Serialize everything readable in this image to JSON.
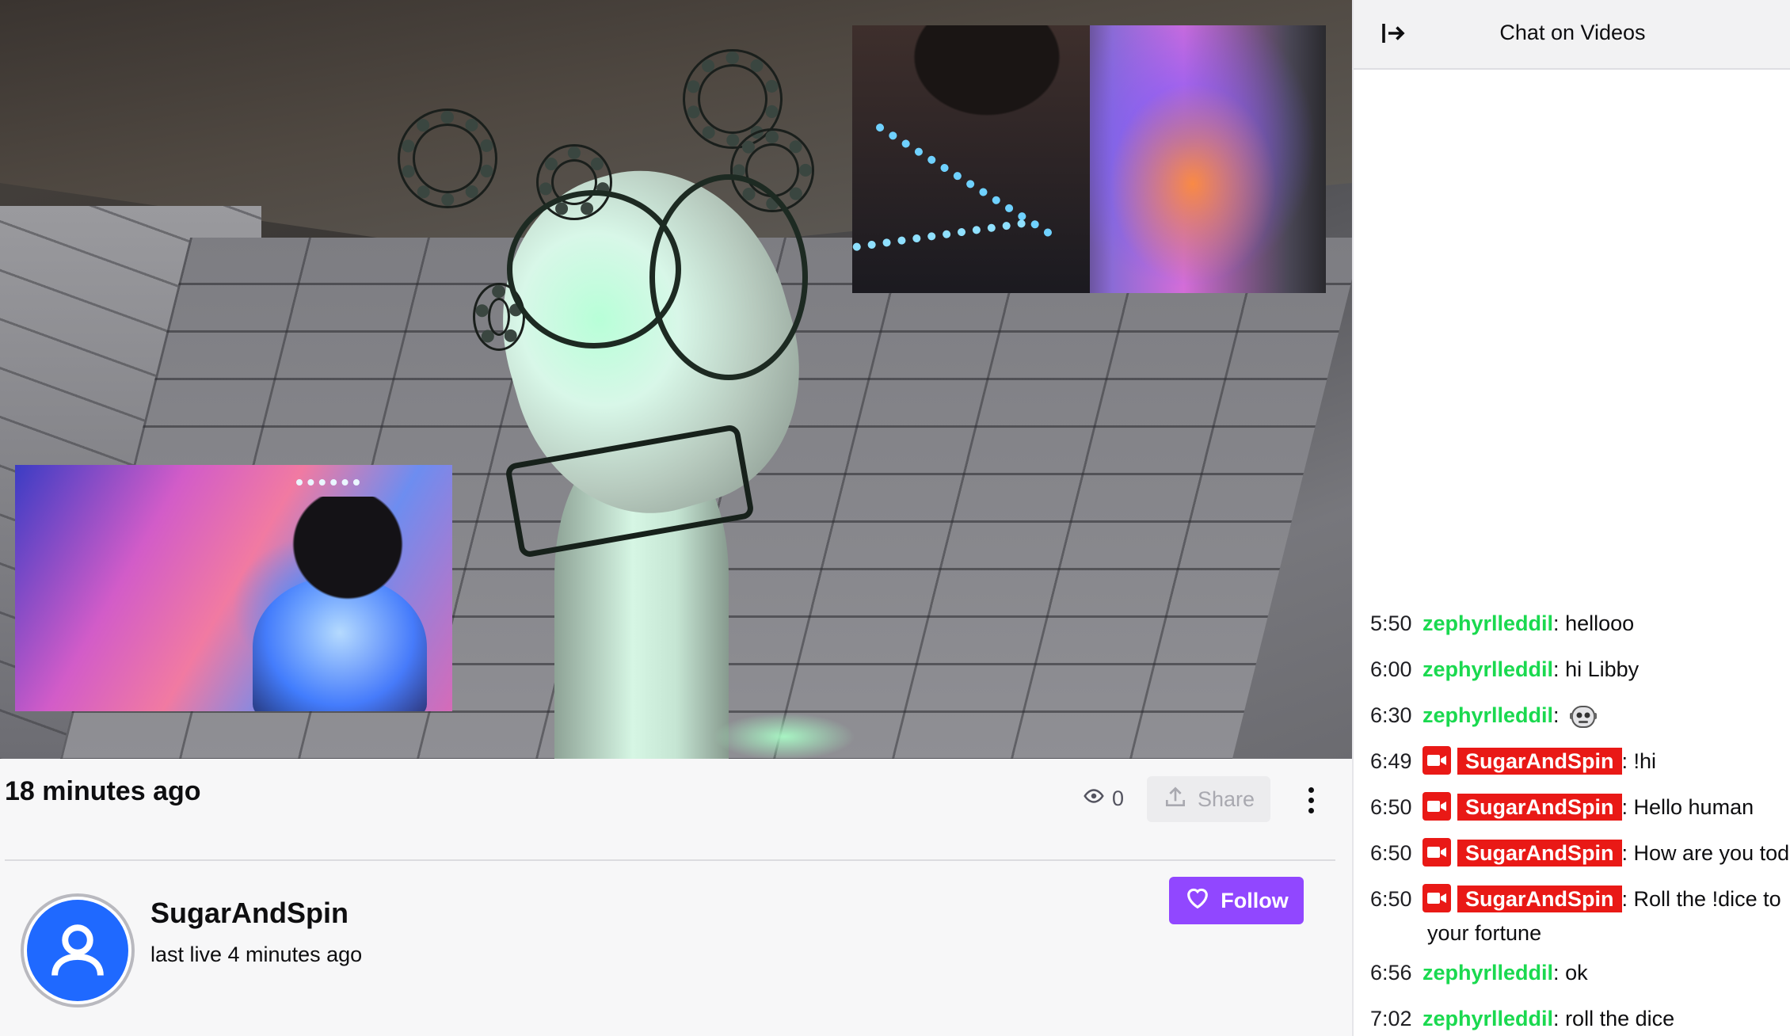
{
  "video": {
    "time_ago": "18 minutes ago",
    "view_count": "0",
    "share_label": "Share"
  },
  "channel": {
    "name": "SugarAndSpin",
    "status": "last live 4 minutes ago",
    "follow_label": "Follow"
  },
  "chat": {
    "title": "Chat on Videos",
    "messages": [
      {
        "time": "5:50",
        "user": "zephyrlleddil",
        "text": "hellooo"
      },
      {
        "time": "6:00",
        "user": "zephyrlleddil",
        "text": "hi Libby"
      },
      {
        "time": "6:30",
        "user": "zephyrlleddil",
        "text": ""
      },
      {
        "time": "6:49",
        "user": "SugarAndSpin",
        "text": "!hi"
      },
      {
        "time": "6:50",
        "user": "SugarAndSpin",
        "text": "Hello human"
      },
      {
        "time": "6:50",
        "user": "SugarAndSpin",
        "text": "How are you tod"
      },
      {
        "time": "6:50",
        "user": "SugarAndSpin",
        "text": "Roll the !dice to",
        "continuation": "your fortune"
      },
      {
        "time": "6:56",
        "user": "zephyrlleddil",
        "text": "ok"
      },
      {
        "time": "7:02",
        "user": "zephyrlleddil",
        "text": "roll the dice"
      }
    ]
  },
  "colors": {
    "accent": "#9147ff",
    "chat_user_green": "#1ad94f",
    "broadcaster_red": "#e91916",
    "avatar_blue": "#1f69ff"
  },
  "icons": {
    "views": "eye-icon",
    "share": "upload-icon",
    "more": "kebab-menu-icon",
    "follow": "heart-icon",
    "collapse": "collapse-arrow-icon",
    "broadcaster_badge": "video-camera-icon",
    "emote": "robot-face-emote"
  }
}
